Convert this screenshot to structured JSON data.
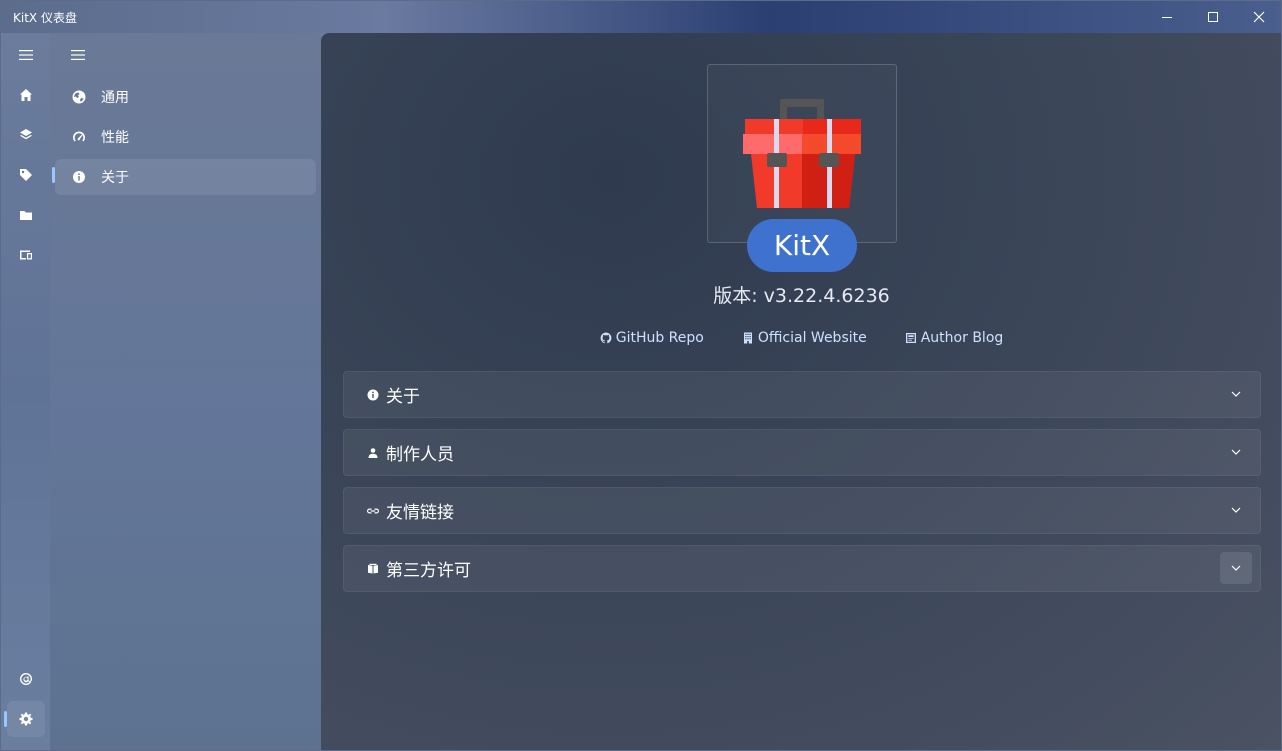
{
  "window": {
    "title": "KitX 仪表盘"
  },
  "nav": {
    "items": [
      {
        "label": "通用",
        "icon": "globe-icon"
      },
      {
        "label": "性能",
        "icon": "speedometer-icon"
      },
      {
        "label": "关于",
        "icon": "info-icon"
      }
    ]
  },
  "about": {
    "app_name": "KitX",
    "version": "版本: v3.22.4.6236",
    "links": [
      {
        "label": "GitHub Repo",
        "icon": "github-icon"
      },
      {
        "label": "Official Website",
        "icon": "building-icon"
      },
      {
        "label": "Author Blog",
        "icon": "blog-icon"
      }
    ],
    "sections": [
      {
        "label": "关于",
        "icon": "info-icon"
      },
      {
        "label": "制作人员",
        "icon": "person-icon"
      },
      {
        "label": "友情链接",
        "icon": "link-icon"
      },
      {
        "label": "第三方许可",
        "icon": "book-icon"
      }
    ]
  },
  "colors": {
    "accent": "#3f72cf",
    "indicator": "#9cc4ff"
  }
}
